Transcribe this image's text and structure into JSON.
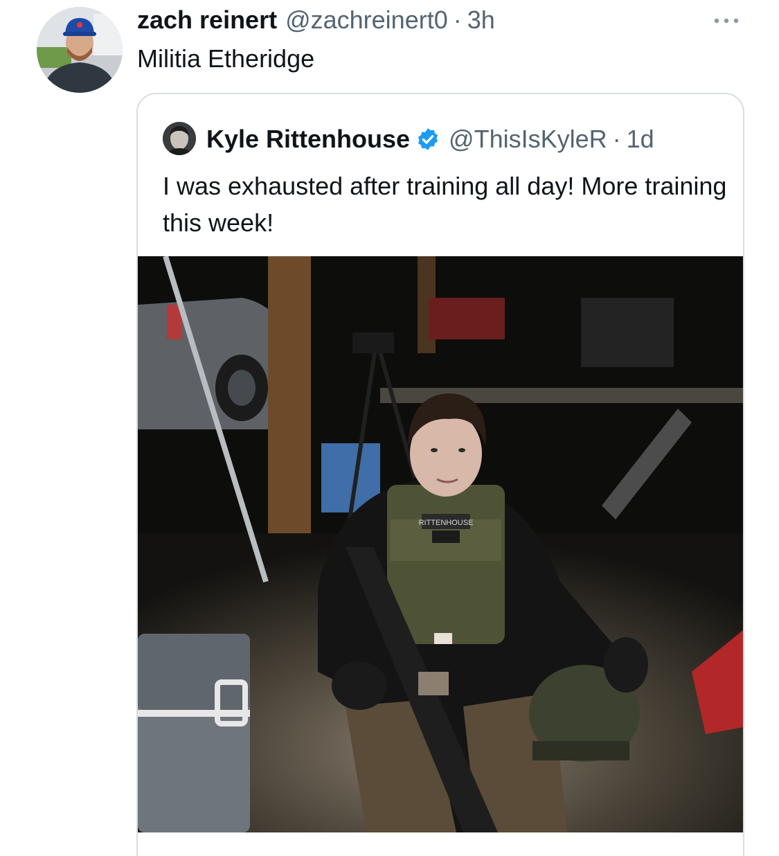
{
  "tweet": {
    "author": {
      "display_name": "zach reinert",
      "handle": "@zachreinert0",
      "time": "3h"
    },
    "separator": "·",
    "text": "Militia Etheridge",
    "more_icon": "ellipsis-icon"
  },
  "quoted_tweet": {
    "author": {
      "display_name": "Kyle Rittenhouse",
      "handle": "@ThisIsKyleR",
      "time": "1d",
      "verified": true
    },
    "separator": "·",
    "text": "I was exhausted after training all day! More training this week!",
    "photo": {
      "patch_text": "RITTENHOUSE"
    }
  },
  "colors": {
    "text_primary": "#0f1419",
    "text_secondary": "#536471",
    "verified_blue": "#1d9bf0",
    "border": "#d7dde2"
  }
}
